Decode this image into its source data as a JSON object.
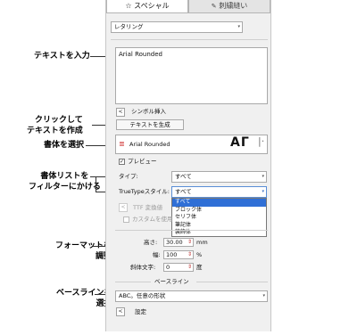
{
  "tabs": [
    {
      "label": "☆ スペシャル"
    },
    {
      "label": "刺繍縫い"
    }
  ],
  "lettering_combo": "レタリング",
  "text_area_value": "Arial Rounded",
  "symbol_insert": "シンボル挿入",
  "generate_text_button": "テキストを生成",
  "font_name": "Arial Rounded",
  "font_preview": "AΓ",
  "preview_label": "プレビュー",
  "type_label": "タイプ:",
  "type_value": "すべて",
  "truetype_style_label": "TrueTypeスタイル:",
  "truetype_style_value": "すべて",
  "truetype_options": [
    "すべて",
    "ブロック体",
    "セリフ体",
    "筆記体",
    "装飾体"
  ],
  "ttf_convert_label": "TTF 変換値",
  "custom_use_label": "カスタムを使用",
  "height_label": "高さ:",
  "height_value": "30.00",
  "height_unit": "mm",
  "width_label": "幅:",
  "width_value": "100",
  "width_unit": "%",
  "slant_label": "斜体文字:",
  "slant_value": "0",
  "slant_unit": "度",
  "baseline_group": "ベースライン",
  "baseline_value": "ABC。任意の形状",
  "settings_label": "設定",
  "callouts": {
    "enter_text": "テキストを入力",
    "click_create": "クリックして\nテキストを作成",
    "select_font": "書体を選択",
    "filter_fonts": "書体リストを\nフィルターにかける",
    "adjust_format": "フォーマットを\n調整",
    "select_baseline": "ベースラインを\n選択"
  },
  "colors": {
    "accent": "#2f6fd6",
    "panel": "#f0f0f0",
    "font_icon": "#d23b3b"
  }
}
